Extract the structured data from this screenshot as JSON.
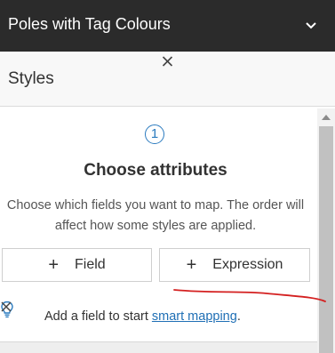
{
  "topbar": {
    "title": "Poles with Tag Colours",
    "chevron_icon": "chevron-down-icon"
  },
  "panel": {
    "title": "Styles",
    "close_icon": "close-icon"
  },
  "step": {
    "number": "1"
  },
  "section": {
    "heading": "Choose attributes",
    "description": "Choose which fields you want to map. The order will affect how some styles are applied."
  },
  "buttons": {
    "field": {
      "plus": "+",
      "label": "Field"
    },
    "expression": {
      "plus": "+",
      "label": "Expression"
    }
  },
  "notice": {
    "text_before": "Add a field to start ",
    "link": "smart mapping",
    "text_after": ".",
    "icon": "lightbulb-icon",
    "close_icon": "close-icon"
  },
  "colors": {
    "topbar": "#2b2b2b",
    "accent": "#2b7bbf",
    "link": "#1f6fb5",
    "annotation": "#d42020"
  }
}
